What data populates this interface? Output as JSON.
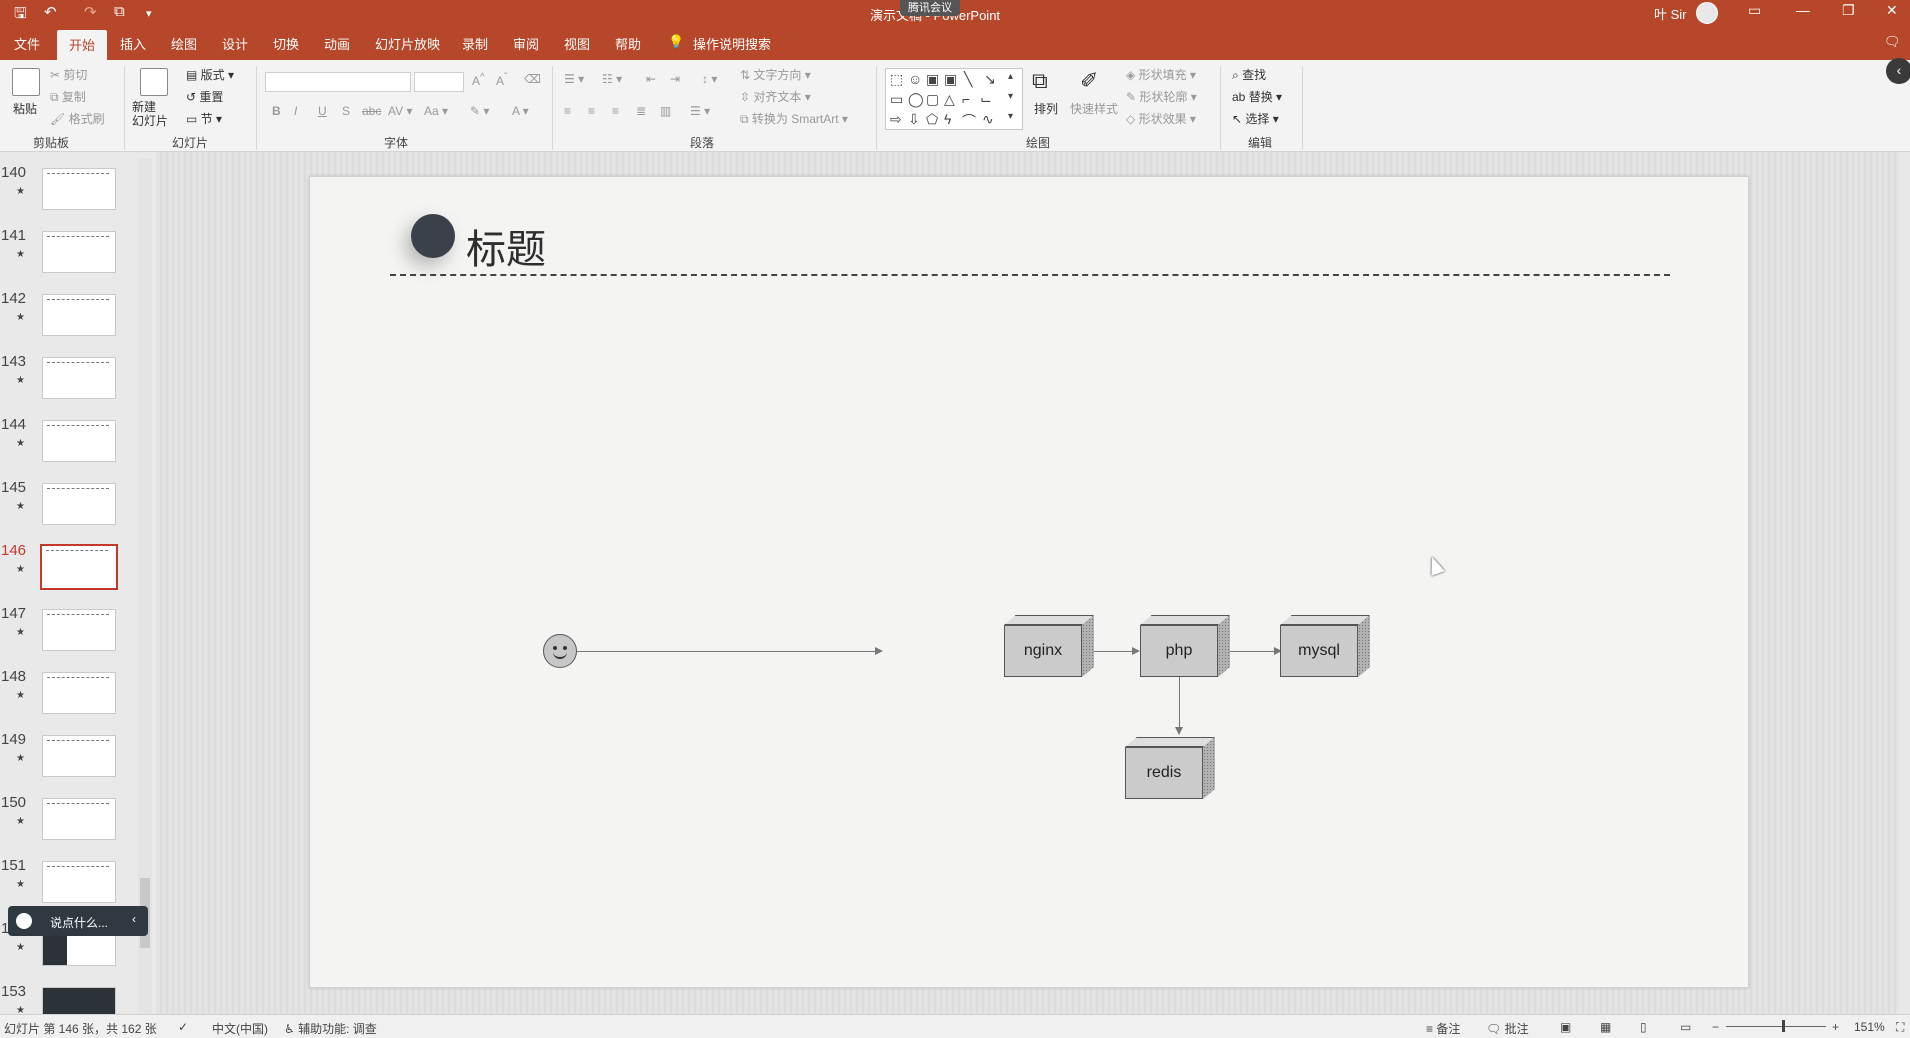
{
  "window": {
    "title": "演示文稿 - PowerPoint",
    "meeting_badge": "腾讯会议",
    "user": "叶 Sir",
    "controls": [
      "▭",
      "—",
      "❐",
      "✕"
    ]
  },
  "tabs": [
    "文件",
    "开始",
    "插入",
    "绘图",
    "设计",
    "切换",
    "动画",
    "幻灯片放映",
    "录制",
    "审阅",
    "视图",
    "帮助",
    "操作说明搜索"
  ],
  "active_tab": "开始",
  "ribbon": {
    "clipboard": {
      "label": "剪贴板",
      "paste": "粘贴",
      "cut": "剪切",
      "copy": "复制",
      "format_painter": "格式刷"
    },
    "slides": {
      "label": "幻灯片",
      "new_slide": "新建\n幻灯片",
      "layout": "版式",
      "reset": "重置",
      "section": "节"
    },
    "font": {
      "label": "字体"
    },
    "paragraph": {
      "label": "段落",
      "text_direction": "文字方向",
      "align_text": "对齐文本",
      "convert_smartart": "转换为 SmartArt"
    },
    "drawing": {
      "label": "绘图",
      "arrange": "排列",
      "quick_styles": "快速样式",
      "shape_fill": "形状填充",
      "shape_outline": "形状轮廓",
      "shape_effects": "形状效果"
    },
    "editing": {
      "label": "编辑",
      "find": "查找",
      "replace": "替换",
      "select": "选择"
    }
  },
  "thumbnails": [
    {
      "num": "140",
      "selected": false
    },
    {
      "num": "141",
      "selected": false
    },
    {
      "num": "142",
      "selected": false
    },
    {
      "num": "143",
      "selected": false
    },
    {
      "num": "144",
      "selected": false
    },
    {
      "num": "145",
      "selected": false
    },
    {
      "num": "146",
      "selected": true
    },
    {
      "num": "147",
      "selected": false
    },
    {
      "num": "148",
      "selected": false
    },
    {
      "num": "149",
      "selected": false
    },
    {
      "num": "150",
      "selected": false
    },
    {
      "num": "151",
      "selected": false
    },
    {
      "num": "152",
      "selected": false
    },
    {
      "num": "153",
      "selected": false
    }
  ],
  "chat": {
    "placeholder": "说点什么..."
  },
  "slide": {
    "title": "标题",
    "nodes": {
      "nginx": "nginx",
      "php": "php",
      "mysql": "mysql",
      "redis": "redis"
    }
  },
  "status": {
    "slide_info": "幻灯片 第 146 张，共 162 张",
    "language": "中文(中国)",
    "accessibility": "辅助功能: 调查",
    "notes": "备注",
    "comments": "批注",
    "zoom": "151%"
  },
  "colors": {
    "accent": "#b7472a",
    "selected": "#c0392b"
  }
}
